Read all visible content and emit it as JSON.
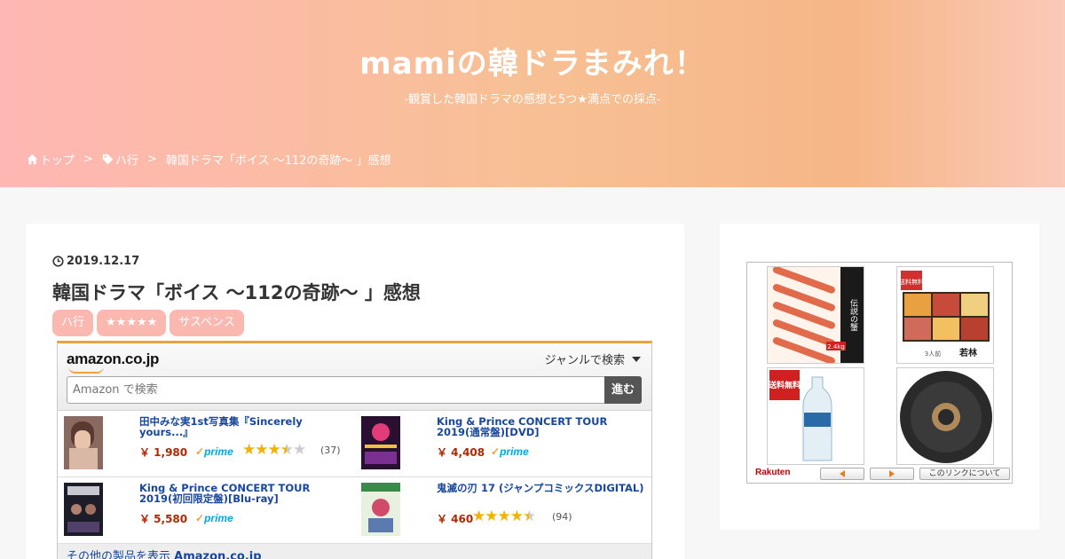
{
  "header": {
    "site_title": "mamiの韓ドラまみれ！",
    "site_desc": "-観賞した韓国ドラマの感想と5つ★満点での採点-",
    "breadcrumb": [
      {
        "label": "トップ",
        "icon": "home-icon"
      },
      {
        "label": "ハ行",
        "icon": "tag-icon"
      },
      {
        "label": "韓国ドラマ「ボイス 〜112の奇跡〜 」感想"
      }
    ],
    "separator": ">"
  },
  "post": {
    "date": "2019.12.17",
    "title": "韓国ドラマ「ボイス 〜112の奇跡〜 」感想",
    "tags": [
      "ハ行",
      "★★★★★",
      "サスペンス"
    ]
  },
  "amazon_widget": {
    "logo": "amazon.co.jp",
    "genre_label": "ジャンルで検索",
    "search_placeholder": "Amazon で検索",
    "go_label": "進む",
    "products": [
      {
        "title": "田中みな実1st写真集『Sincerely yours...』",
        "price": "￥ 1,980",
        "prime": true,
        "rating": 3.5,
        "reviews": "(37)"
      },
      {
        "title": "King & Prince CONCERT TOUR 2019(通常盤)[DVD]",
        "price": "￥ 4,408",
        "prime": true
      },
      {
        "title": "King & Prince CONCERT TOUR 2019(初回限定盤)[Blu-ray]",
        "price": "￥ 5,580",
        "prime": true
      },
      {
        "title": "鬼滅の刃 17 (ジャンプコミックスDIGITAL)",
        "price": "￥ 460",
        "prime": false,
        "rating": 4.5,
        "reviews": "(94)"
      }
    ],
    "prime_label": "prime",
    "footer_prefix": "その他の製品を表示",
    "footer_link": "Amazon.co.jp"
  },
  "rakuten_widget": {
    "logo": "Rakuten",
    "prev_label": "",
    "next_label": "",
    "about_label": "このリンクについて",
    "item_texts": [
      "伝説の蟹",
      "送料無料",
      "送料無料",
      "若林",
      "2.4kg",
      "3人前"
    ]
  }
}
